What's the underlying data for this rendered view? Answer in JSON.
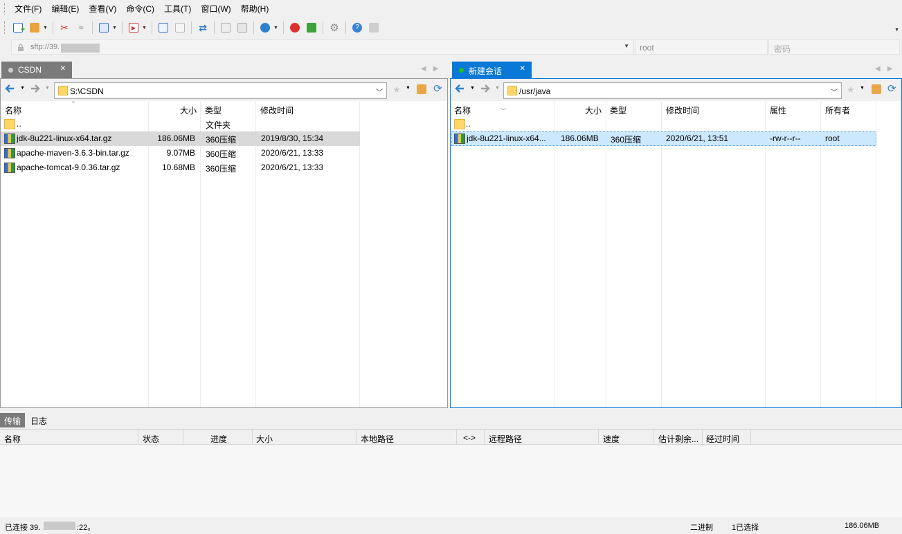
{
  "menu": [
    "文件(F)",
    "编辑(E)",
    "查看(V)",
    "命令(C)",
    "工具(T)",
    "窗口(W)",
    "帮助(H)"
  ],
  "address": {
    "url": "sftp://39.",
    "user": "root",
    "password_placeholder": "密码"
  },
  "left": {
    "tab_label": "CSDN",
    "path": "S:\\CSDN",
    "columns": [
      "名称",
      "大小",
      "类型",
      "修改时间"
    ],
    "rows": [
      {
        "name": "..",
        "size": "",
        "type": "文件夹",
        "modified": ""
      },
      {
        "name": "jdk-8u221-linux-x64.tar.gz",
        "size": "186.06MB",
        "type": "360压缩",
        "modified": "2019/8/30, 15:34"
      },
      {
        "name": "apache-maven-3.6.3-bin.tar.gz",
        "size": "9.07MB",
        "type": "360压缩",
        "modified": "2020/6/21, 13:33"
      },
      {
        "name": "apache-tomcat-9.0.36.tar.gz",
        "size": "10.68MB",
        "type": "360压缩",
        "modified": "2020/6/21, 13:33"
      }
    ]
  },
  "right": {
    "tab_label": "新建会话",
    "path": "/usr/java",
    "columns": [
      "名称",
      "大小",
      "类型",
      "修改时间",
      "属性",
      "所有者"
    ],
    "rows": [
      {
        "name": "..",
        "size": "",
        "type": "",
        "modified": "",
        "attr": "",
        "owner": ""
      },
      {
        "name": "jdk-8u221-linux-x64...",
        "size": "186.06MB",
        "type": "360压缩",
        "modified": "2020/6/21, 13:51",
        "attr": "-rw-r--r--",
        "owner": "root"
      }
    ]
  },
  "log": {
    "tabs": [
      "传输",
      "日志"
    ],
    "columns": [
      "名称",
      "状态",
      "进度",
      "大小",
      "本地路径",
      "<->",
      "远程路径",
      "速度",
      "估计剩余...",
      "经过时间"
    ]
  },
  "status": {
    "connected": "已连接 39.",
    "port": ":22。",
    "mode": "二进制",
    "selected": "1已选择",
    "size": "186.06MB"
  }
}
